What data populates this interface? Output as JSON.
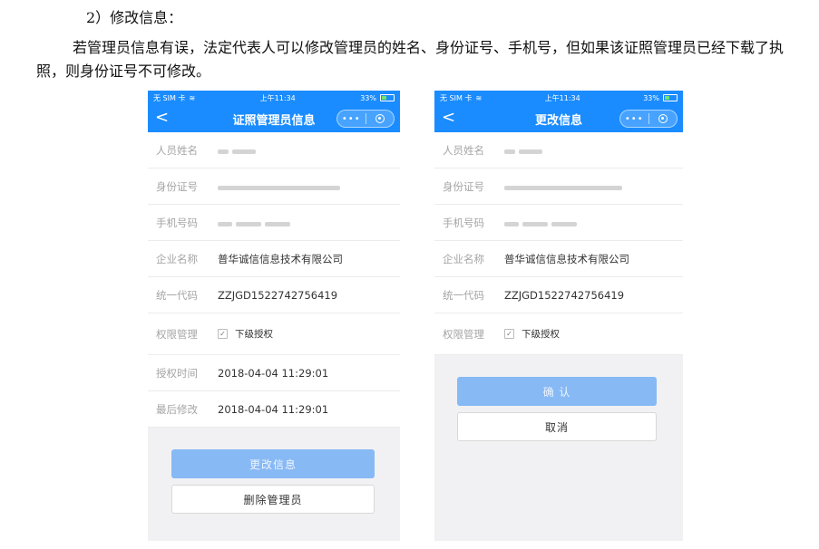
{
  "doc": {
    "heading": "2）修改信息：",
    "paragraph": "若管理员信息有误，法定代表人可以修改管理员的姓名、身份证号、手机号，但如果该证照管理员已经下载了执照，则身份证号不可修改。"
  },
  "status_bar": {
    "carrier": "无 SIM 卡",
    "time": "上午11:34",
    "battery": "33%"
  },
  "colors": {
    "brand": "#1a8cff",
    "button_disabled": "#87b9f5"
  },
  "screen1": {
    "title": "证照管理员信息",
    "fields": [
      {
        "label": "人员姓名"
      },
      {
        "label": "身份证号"
      },
      {
        "label": "手机号码"
      },
      {
        "label": "企业名称",
        "value": "普华诚信信息技术有限公司"
      },
      {
        "label": "统一代码",
        "value": "ZZJGD1522742756419"
      },
      {
        "label": "权限管理",
        "checkbox": "下级授权"
      },
      {
        "label": "授权时间",
        "value": "2018-04-04 11:29:01"
      },
      {
        "label": "最后修改",
        "value": "2018-04-04 11:29:01"
      }
    ],
    "primary_button": "更改信息",
    "secondary_button": "删除管理员"
  },
  "screen2": {
    "title": "更改信息",
    "fields": [
      {
        "label": "人员姓名"
      },
      {
        "label": "身份证号"
      },
      {
        "label": "手机号码"
      },
      {
        "label": "企业名称",
        "value": "普华诚信信息技术有限公司"
      },
      {
        "label": "统一代码",
        "value": "ZZJGD1522742756419"
      },
      {
        "label": "权限管理",
        "checkbox": "下级授权"
      }
    ],
    "primary_button": "确 认",
    "secondary_button": "取消"
  },
  "icons": [
    "wifi-icon",
    "back-icon",
    "more-icon",
    "close-circle-icon",
    "checkbox-icon",
    "battery-icon"
  ]
}
